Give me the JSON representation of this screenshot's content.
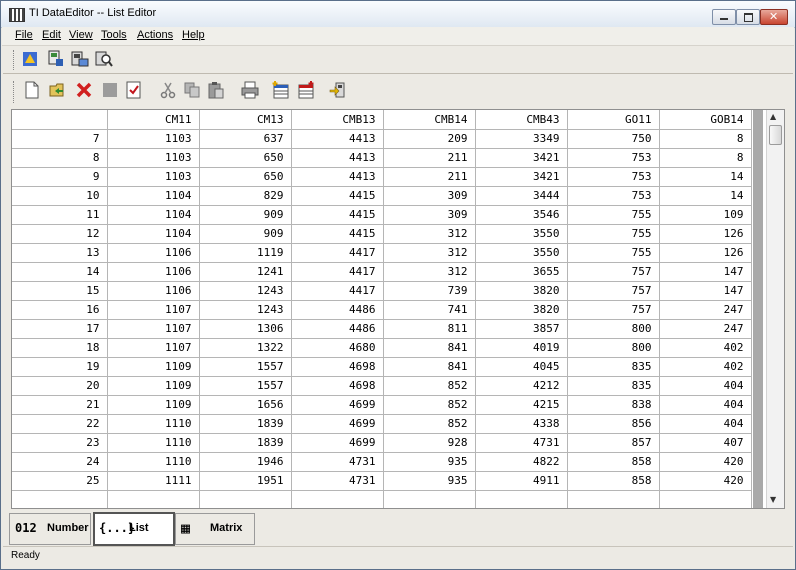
{
  "window": {
    "title": "TI DataEditor -- List Editor",
    "controls": {
      "minimize": "minimize",
      "maximize": "maximize",
      "close": "✕"
    }
  },
  "menu": [
    "File",
    "Edit",
    "View",
    "Tools",
    "Actions",
    "Help"
  ],
  "toolbar_top": [
    "send-to-device-icon",
    "connect-icon",
    "screenshot-icon",
    "explore-icon"
  ],
  "toolbar_main": [
    "new-icon",
    "open-icon",
    "delete-icon",
    "stop-icon",
    "validate-icon",
    "cut-icon",
    "copy-icon",
    "paste-icon",
    "print-icon",
    "insert-row-icon",
    "insert-column-icon",
    "send-icon"
  ],
  "grid": {
    "columns": [
      "CM11",
      "CM13",
      "CMB13",
      "CMB14",
      "CMB43",
      "GO11",
      "GOB14"
    ],
    "rows": [
      {
        "label": "7",
        "cells": [
          "1103",
          "637",
          "4413",
          "209",
          "3349",
          "750",
          "8"
        ]
      },
      {
        "label": "8",
        "cells": [
          "1103",
          "650",
          "4413",
          "211",
          "3421",
          "753",
          "8"
        ]
      },
      {
        "label": "9",
        "cells": [
          "1103",
          "650",
          "4413",
          "211",
          "3421",
          "753",
          "14"
        ]
      },
      {
        "label": "10",
        "cells": [
          "1104",
          "829",
          "4415",
          "309",
          "3444",
          "753",
          "14"
        ]
      },
      {
        "label": "11",
        "cells": [
          "1104",
          "909",
          "4415",
          "309",
          "3546",
          "755",
          "109"
        ]
      },
      {
        "label": "12",
        "cells": [
          "1104",
          "909",
          "4415",
          "312",
          "3550",
          "755",
          "126"
        ]
      },
      {
        "label": "13",
        "cells": [
          "1106",
          "1119",
          "4417",
          "312",
          "3550",
          "755",
          "126"
        ]
      },
      {
        "label": "14",
        "cells": [
          "1106",
          "1241",
          "4417",
          "312",
          "3655",
          "757",
          "147"
        ]
      },
      {
        "label": "15",
        "cells": [
          "1106",
          "1243",
          "4417",
          "739",
          "3820",
          "757",
          "147"
        ]
      },
      {
        "label": "16",
        "cells": [
          "1107",
          "1243",
          "4486",
          "741",
          "3820",
          "757",
          "247"
        ]
      },
      {
        "label": "17",
        "cells": [
          "1107",
          "1306",
          "4486",
          "811",
          "3857",
          "800",
          "247"
        ]
      },
      {
        "label": "18",
        "cells": [
          "1107",
          "1322",
          "4680",
          "841",
          "4019",
          "800",
          "402"
        ]
      },
      {
        "label": "19",
        "cells": [
          "1109",
          "1557",
          "4698",
          "841",
          "4045",
          "835",
          "402"
        ]
      },
      {
        "label": "20",
        "cells": [
          "1109",
          "1557",
          "4698",
          "852",
          "4212",
          "835",
          "404"
        ]
      },
      {
        "label": "21",
        "cells": [
          "1109",
          "1656",
          "4699",
          "852",
          "4215",
          "838",
          "404"
        ]
      },
      {
        "label": "22",
        "cells": [
          "1110",
          "1839",
          "4699",
          "852",
          "4338",
          "856",
          "404"
        ]
      },
      {
        "label": "23",
        "cells": [
          "1110",
          "1839",
          "4699",
          "928",
          "4731",
          "857",
          "407"
        ]
      },
      {
        "label": "24",
        "cells": [
          "1110",
          "1946",
          "4731",
          "935",
          "4822",
          "858",
          "420"
        ]
      },
      {
        "label": "25",
        "cells": [
          "1111",
          "1951",
          "4731",
          "935",
          "4911",
          "858",
          "420"
        ]
      },
      {
        "label": "",
        "cells": [
          "",
          "",
          "",
          "",
          "",
          "",
          ""
        ]
      }
    ]
  },
  "tabs": [
    {
      "glyph": "012",
      "label": "Number",
      "active": false
    },
    {
      "glyph": "{...}",
      "label": "List",
      "active": true
    },
    {
      "glyph": "▦",
      "label": "Matrix",
      "active": false
    }
  ],
  "status": "Ready"
}
